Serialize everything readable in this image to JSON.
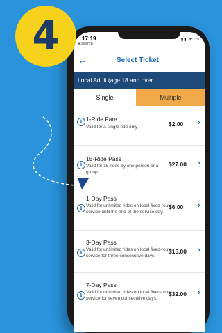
{
  "step": {
    "number": "4"
  },
  "status": {
    "time": "17:19",
    "back_label": "◂ Search",
    "icons": "▮▮ ᯤ ▭"
  },
  "nav": {
    "title": "Select Ticket",
    "back_icon": "back-arrow-icon"
  },
  "rider": {
    "label": "Local Adult (age 18 and over..."
  },
  "tabs": {
    "single": "Single",
    "multiple": "Multiple",
    "active": "Single"
  },
  "tickets": [
    {
      "name": "1-Ride Fare",
      "desc": "Valid for a single ride only",
      "price": "$2.00"
    },
    {
      "name": "15-Ride Pass",
      "desc": "Valid for 15 rides by one person or a group.",
      "price": "$27.00"
    },
    {
      "name": "1-Day Pass",
      "desc": "Valid for unlimited rides on local fixed-route service until the end of the service day.",
      "price": "$6.00"
    },
    {
      "name": "3-Day Pass",
      "desc": "Valid for unlimited rides on local fixed-route service for three consecutive days.",
      "price": "$15.00"
    },
    {
      "name": "7-Day Pass",
      "desc": "Valid for unlimited rides on local fixed-route service for seven consecutive days.",
      "price": "$32.00"
    }
  ],
  "colors": {
    "background": "#2a93dc",
    "badge": "#f6d21c",
    "accent": "#1e66b8",
    "rider_bar": "#1e4a7a",
    "multiple_tab": "#f1a94a"
  }
}
